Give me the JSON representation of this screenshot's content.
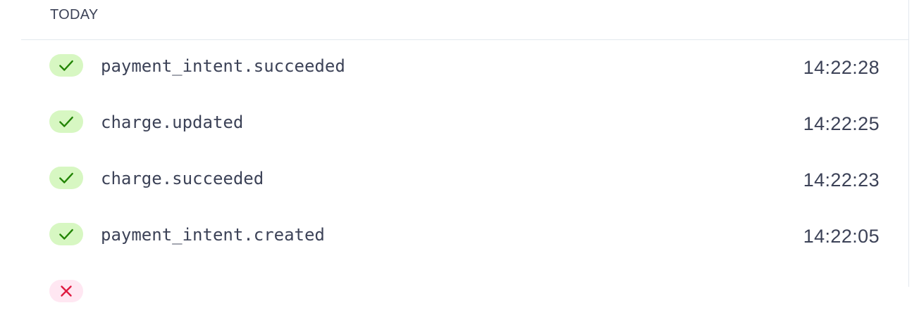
{
  "section": {
    "title": "TODAY"
  },
  "events": [
    {
      "name": "payment_intent.succeeded",
      "time": "14:22:28",
      "status": "succeeded",
      "status_icon": "check-icon"
    },
    {
      "name": "charge.updated",
      "time": "14:22:25",
      "status": "succeeded",
      "status_icon": "check-icon"
    },
    {
      "name": "charge.succeeded",
      "time": "14:22:23",
      "status": "succeeded",
      "status_icon": "check-icon"
    },
    {
      "name": "payment_intent.created",
      "time": "14:22:05",
      "status": "succeeded",
      "status_icon": "check-icon"
    },
    {
      "name": "",
      "time": "",
      "status": "failed",
      "status_icon": "x-icon"
    }
  ],
  "colors": {
    "success_bg": "#d7f7c2",
    "success_fg": "#228403",
    "failed_bg": "#ffe7f2",
    "failed_fg": "#df1b41",
    "text": "#3c4257",
    "divider": "#e3e8ee"
  }
}
